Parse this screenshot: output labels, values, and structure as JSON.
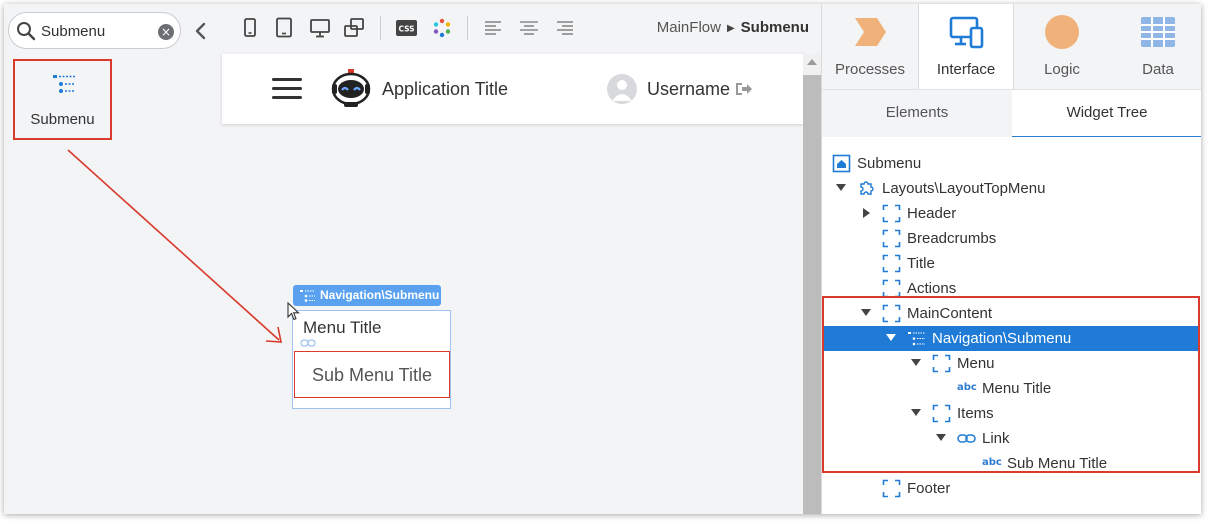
{
  "search": {
    "value": "Submenu",
    "clear_glyph": "×"
  },
  "widget_palette": {
    "label": "Submenu",
    "icon": "submenu-icon"
  },
  "toolbar": {
    "device_icons": [
      "phone-icon",
      "tablet-icon",
      "desktop-icon",
      "rotate-icon"
    ],
    "tool_icons": [
      "css-icon",
      "theme-icon"
    ],
    "css_label": "CSS",
    "align_icons": [
      "align-left-icon",
      "align-center-icon",
      "align-right-icon"
    ]
  },
  "breadcrumb": {
    "flow": "MainFlow",
    "screen": "Submenu"
  },
  "app_preview": {
    "title": "Application Title",
    "username": "Username"
  },
  "submenu_widget": {
    "badge": "Navigation\\Submenu",
    "menu_title": "Menu Title",
    "sub_menu_title": "Sub Menu Title"
  },
  "right_panel": {
    "main_tabs": [
      {
        "label": "Processes",
        "icon": "processes-icon"
      },
      {
        "label": "Interface",
        "icon": "interface-icon"
      },
      {
        "label": "Logic",
        "icon": "logic-icon"
      },
      {
        "label": "Data",
        "icon": "data-icon"
      }
    ],
    "sub_tabs": [
      {
        "label": "Elements"
      },
      {
        "label": "Widget Tree"
      }
    ],
    "tree": [
      {
        "label": "Submenu",
        "icon": "screen-icon"
      },
      {
        "label": "Layouts\\LayoutTopMenu",
        "icon": "block-icon"
      },
      {
        "label": "Header",
        "icon": "placeholder-icon"
      },
      {
        "label": "Breadcrumbs",
        "icon": "placeholder-icon"
      },
      {
        "label": "Title",
        "icon": "placeholder-icon"
      },
      {
        "label": "Actions",
        "icon": "placeholder-icon"
      },
      {
        "label": "MainContent",
        "icon": "placeholder-icon"
      },
      {
        "label": "Navigation\\Submenu",
        "icon": "submenu-icon"
      },
      {
        "label": "Menu",
        "icon": "placeholder-icon"
      },
      {
        "label": "Menu Title",
        "icon": "text-icon",
        "abc": "abc"
      },
      {
        "label": "Items",
        "icon": "placeholder-icon"
      },
      {
        "label": "Link",
        "icon": "link-icon"
      },
      {
        "label": "Sub Menu Title",
        "icon": "text-icon",
        "abc": "abc"
      },
      {
        "label": "Footer",
        "icon": "placeholder-icon"
      }
    ]
  },
  "colors": {
    "accent": "#1f7bd6",
    "highlight": "#d93a2b",
    "badge": "#5aa2f0",
    "processes": "#f0b27a",
    "logic": "#f0b27a",
    "interface": "#1f7bd6",
    "data": "#8fb6e6"
  }
}
